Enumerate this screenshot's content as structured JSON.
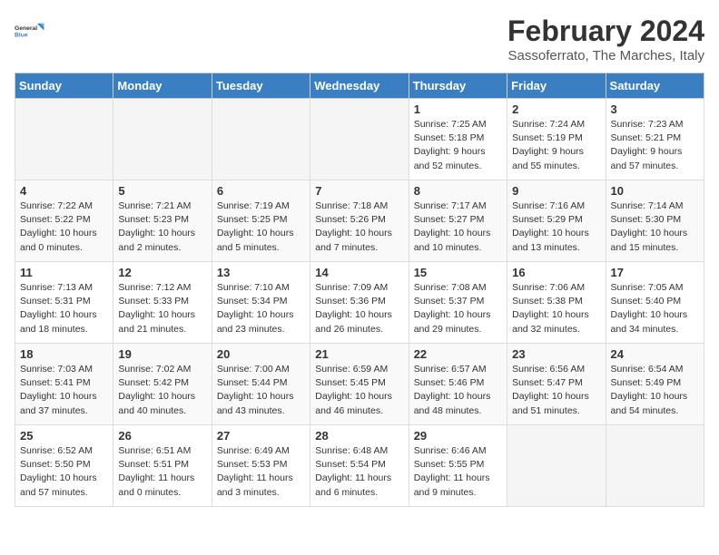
{
  "logo": {
    "line1": "General",
    "line2": "Blue"
  },
  "title": "February 2024",
  "subtitle": "Sassoferrato, The Marches, Italy",
  "weekdays": [
    "Sunday",
    "Monday",
    "Tuesday",
    "Wednesday",
    "Thursday",
    "Friday",
    "Saturday"
  ],
  "weeks": [
    [
      {
        "day": "",
        "info": ""
      },
      {
        "day": "",
        "info": ""
      },
      {
        "day": "",
        "info": ""
      },
      {
        "day": "",
        "info": ""
      },
      {
        "day": "1",
        "info": "Sunrise: 7:25 AM\nSunset: 5:18 PM\nDaylight: 9 hours\nand 52 minutes."
      },
      {
        "day": "2",
        "info": "Sunrise: 7:24 AM\nSunset: 5:19 PM\nDaylight: 9 hours\nand 55 minutes."
      },
      {
        "day": "3",
        "info": "Sunrise: 7:23 AM\nSunset: 5:21 PM\nDaylight: 9 hours\nand 57 minutes."
      }
    ],
    [
      {
        "day": "4",
        "info": "Sunrise: 7:22 AM\nSunset: 5:22 PM\nDaylight: 10 hours\nand 0 minutes."
      },
      {
        "day": "5",
        "info": "Sunrise: 7:21 AM\nSunset: 5:23 PM\nDaylight: 10 hours\nand 2 minutes."
      },
      {
        "day": "6",
        "info": "Sunrise: 7:19 AM\nSunset: 5:25 PM\nDaylight: 10 hours\nand 5 minutes."
      },
      {
        "day": "7",
        "info": "Sunrise: 7:18 AM\nSunset: 5:26 PM\nDaylight: 10 hours\nand 7 minutes."
      },
      {
        "day": "8",
        "info": "Sunrise: 7:17 AM\nSunset: 5:27 PM\nDaylight: 10 hours\nand 10 minutes."
      },
      {
        "day": "9",
        "info": "Sunrise: 7:16 AM\nSunset: 5:29 PM\nDaylight: 10 hours\nand 13 minutes."
      },
      {
        "day": "10",
        "info": "Sunrise: 7:14 AM\nSunset: 5:30 PM\nDaylight: 10 hours\nand 15 minutes."
      }
    ],
    [
      {
        "day": "11",
        "info": "Sunrise: 7:13 AM\nSunset: 5:31 PM\nDaylight: 10 hours\nand 18 minutes."
      },
      {
        "day": "12",
        "info": "Sunrise: 7:12 AM\nSunset: 5:33 PM\nDaylight: 10 hours\nand 21 minutes."
      },
      {
        "day": "13",
        "info": "Sunrise: 7:10 AM\nSunset: 5:34 PM\nDaylight: 10 hours\nand 23 minutes."
      },
      {
        "day": "14",
        "info": "Sunrise: 7:09 AM\nSunset: 5:36 PM\nDaylight: 10 hours\nand 26 minutes."
      },
      {
        "day": "15",
        "info": "Sunrise: 7:08 AM\nSunset: 5:37 PM\nDaylight: 10 hours\nand 29 minutes."
      },
      {
        "day": "16",
        "info": "Sunrise: 7:06 AM\nSunset: 5:38 PM\nDaylight: 10 hours\nand 32 minutes."
      },
      {
        "day": "17",
        "info": "Sunrise: 7:05 AM\nSunset: 5:40 PM\nDaylight: 10 hours\nand 34 minutes."
      }
    ],
    [
      {
        "day": "18",
        "info": "Sunrise: 7:03 AM\nSunset: 5:41 PM\nDaylight: 10 hours\nand 37 minutes."
      },
      {
        "day": "19",
        "info": "Sunrise: 7:02 AM\nSunset: 5:42 PM\nDaylight: 10 hours\nand 40 minutes."
      },
      {
        "day": "20",
        "info": "Sunrise: 7:00 AM\nSunset: 5:44 PM\nDaylight: 10 hours\nand 43 minutes."
      },
      {
        "day": "21",
        "info": "Sunrise: 6:59 AM\nSunset: 5:45 PM\nDaylight: 10 hours\nand 46 minutes."
      },
      {
        "day": "22",
        "info": "Sunrise: 6:57 AM\nSunset: 5:46 PM\nDaylight: 10 hours\nand 48 minutes."
      },
      {
        "day": "23",
        "info": "Sunrise: 6:56 AM\nSunset: 5:47 PM\nDaylight: 10 hours\nand 51 minutes."
      },
      {
        "day": "24",
        "info": "Sunrise: 6:54 AM\nSunset: 5:49 PM\nDaylight: 10 hours\nand 54 minutes."
      }
    ],
    [
      {
        "day": "25",
        "info": "Sunrise: 6:52 AM\nSunset: 5:50 PM\nDaylight: 10 hours\nand 57 minutes."
      },
      {
        "day": "26",
        "info": "Sunrise: 6:51 AM\nSunset: 5:51 PM\nDaylight: 11 hours\nand 0 minutes."
      },
      {
        "day": "27",
        "info": "Sunrise: 6:49 AM\nSunset: 5:53 PM\nDaylight: 11 hours\nand 3 minutes."
      },
      {
        "day": "28",
        "info": "Sunrise: 6:48 AM\nSunset: 5:54 PM\nDaylight: 11 hours\nand 6 minutes."
      },
      {
        "day": "29",
        "info": "Sunrise: 6:46 AM\nSunset: 5:55 PM\nDaylight: 11 hours\nand 9 minutes."
      },
      {
        "day": "",
        "info": ""
      },
      {
        "day": "",
        "info": ""
      }
    ]
  ]
}
